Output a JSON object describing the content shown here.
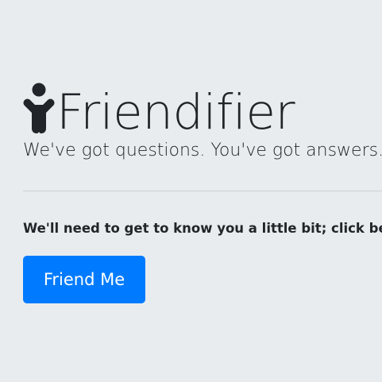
{
  "header": {
    "icon": "child-icon",
    "title": "Friendifier",
    "tagline": "We've got questions. You've got answers."
  },
  "main": {
    "intro_text": "We'll need to get to know you a little bit; click below to get started.",
    "cta_label": "Friend Me"
  },
  "colors": {
    "background": "#e9ecef",
    "text": "#212529",
    "primary": "#007bff"
  }
}
